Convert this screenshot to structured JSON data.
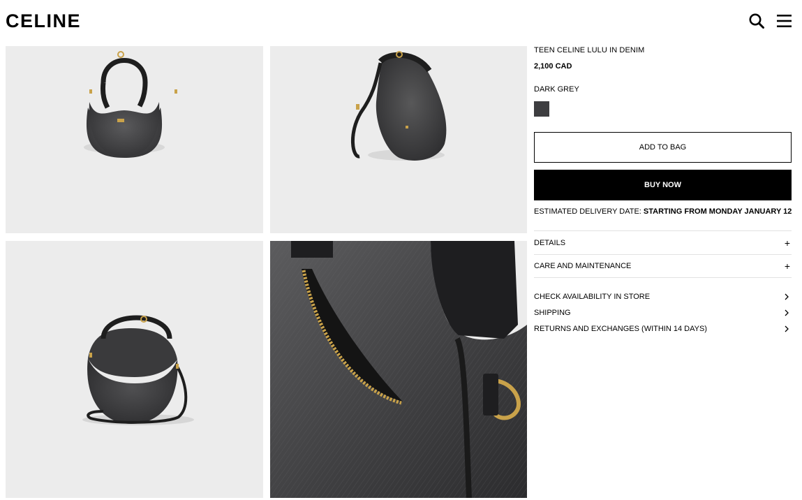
{
  "header": {
    "logo": "CELINE",
    "search_icon": "search-icon",
    "menu_icon": "hamburger-menu-icon"
  },
  "gallery": {
    "images": [
      {
        "name": "bag-front-view"
      },
      {
        "name": "bag-side-view-with-strap"
      },
      {
        "name": "bag-three-quarter-view-with-strap"
      },
      {
        "name": "bag-detail-closeup-zipper"
      }
    ]
  },
  "product": {
    "name": "TEEN CELINE LULU IN DENIM",
    "price": "2,100 CAD",
    "color_label": "DARK GREY",
    "swatch_color": "#3d3d40",
    "add_to_bag": "ADD TO BAG",
    "buy_now": "BUY NOW",
    "delivery_label": "ESTIMATED DELIVERY DATE:",
    "delivery_value": "STARTING FROM MONDAY JANUARY 12"
  },
  "accordion": [
    {
      "label": "DETAILS",
      "icon": "+"
    },
    {
      "label": "CARE AND MAINTENANCE",
      "icon": "+"
    }
  ],
  "links": [
    {
      "label": "CHECK AVAILABILITY IN STORE"
    },
    {
      "label": "SHIPPING"
    },
    {
      "label": "RETURNS AND EXCHANGES (WITHIN 14 DAYS)"
    }
  ]
}
